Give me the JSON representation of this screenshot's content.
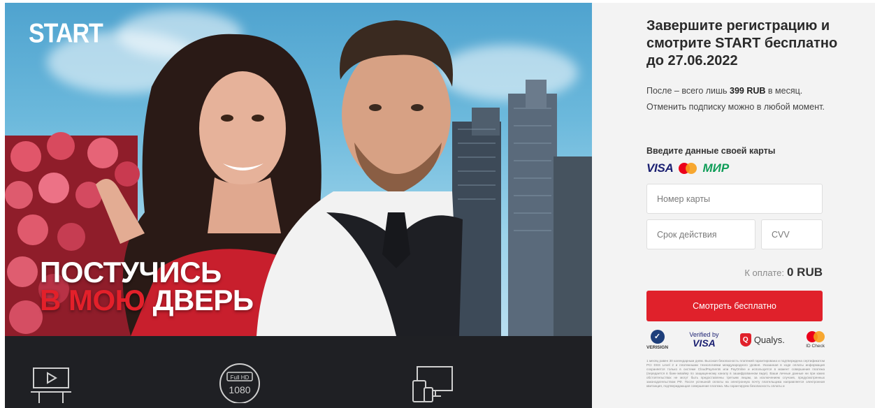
{
  "poster": {
    "logo": "START",
    "title_line1": "ПОСТУЧИСЬ",
    "title_line2_accent": "В МОЮ",
    "title_line2_rest": "ДВЕРЬ"
  },
  "features": [
    {
      "icon": "cinema-screen-icon"
    },
    {
      "icon": "full-hd-icon",
      "badge_top": "Full HD",
      "badge_bottom": "1080"
    },
    {
      "icon": "devices-icon"
    }
  ],
  "form": {
    "title": "Завершите регистрацию и смотрите START бесплатно до 27.06.2022",
    "desc_before": "После – всего лишь ",
    "desc_price": "399 RUB",
    "desc_after": " в месяц. Отменить подписку можно в любой момент.",
    "card_label": "Введите данные своей карты",
    "payment_logos": {
      "visa": "VISA",
      "mir": "МИР"
    },
    "card_number_placeholder": "Номер карты",
    "expiry_placeholder": "Срок действия",
    "cvv_placeholder": "CVV",
    "total_label": "К оплате:",
    "total_value": "0 RUB",
    "cta_label": "Смотреть бесплатно",
    "trust": {
      "verisign": "VERISIGN",
      "vbv_top": "Verified by",
      "vbv_bottom": "VISA",
      "qualys": "Qualys.",
      "mc_idcheck": "ID Check"
    },
    "legal": "1 месяц равен 30 календарным дням. Высокая безопасность платежей гарантирована и подтверждена сертификатом PCI DSS Level 2 и платежными технологиями международного уровня. Указанная в ходе оплаты информация сохраняется только в системе CloudPayments или PayOnline и используется в момент совершения платежа (передается в банк-эквайер по защищенному каналу в зашифрованном виде). Ваши личные данные ни при каких обстоятельствах не могут быть предоставлены третьим лицам, за исключением случаев, предусмотренных законодательством РФ. После успешной оплаты на электронную почту плательщика направляется электронная квитанция, подтверждающая совершение платежа. Мы гарантируем безопасность оплаты и"
  },
  "colors": {
    "accent": "#e0212b",
    "dark_strip": "#1f2024",
    "panel_bg": "#f3f3f3"
  }
}
